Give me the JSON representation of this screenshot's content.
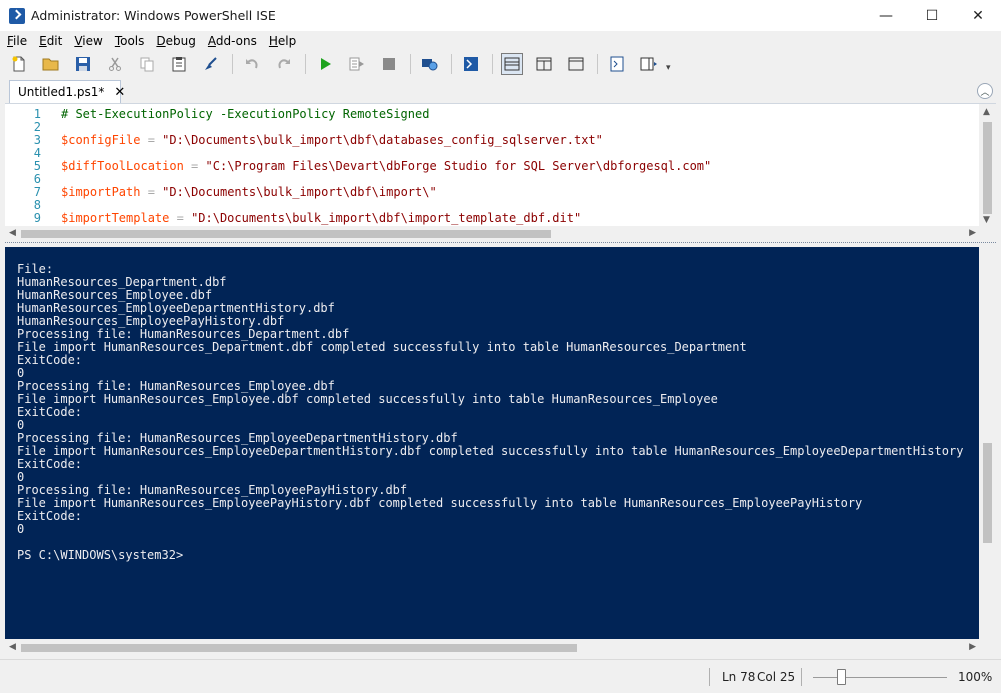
{
  "window": {
    "title": "Administrator: Windows PowerShell ISE",
    "minimize": "—",
    "maximize": "☐",
    "close": "✕"
  },
  "menu": [
    "File",
    "Edit",
    "View",
    "Tools",
    "Debug",
    "Add-ons",
    "Help"
  ],
  "tab": {
    "label": "Untitled1.ps1*",
    "close": "✕"
  },
  "script": {
    "lines": [
      {
        "n": "1",
        "parts": [
          {
            "t": "# Set-ExecutionPolicy -ExecutionPolicy RemoteSigned",
            "c": "comment"
          }
        ]
      },
      {
        "n": "2",
        "parts": []
      },
      {
        "n": "3",
        "parts": [
          {
            "t": "$configFile",
            "c": "var"
          },
          {
            "t": " = ",
            "c": "op"
          },
          {
            "t": "\"D:\\Documents\\bulk_import\\dbf\\databases_config_sqlserver.txt\"",
            "c": "str"
          }
        ]
      },
      {
        "n": "4",
        "parts": []
      },
      {
        "n": "5",
        "parts": [
          {
            "t": "$diffToolLocation",
            "c": "var"
          },
          {
            "t": " = ",
            "c": "op"
          },
          {
            "t": "\"C:\\Program Files\\Devart\\dbForge Studio for SQL Server\\dbforgesql.com\"",
            "c": "str"
          }
        ]
      },
      {
        "n": "6",
        "parts": []
      },
      {
        "n": "7",
        "parts": [
          {
            "t": "$importPath",
            "c": "var"
          },
          {
            "t": " = ",
            "c": "op"
          },
          {
            "t": "\"D:\\Documents\\bulk_import\\dbf\\import\\\"",
            "c": "str"
          }
        ]
      },
      {
        "n": "8",
        "parts": []
      },
      {
        "n": "9",
        "parts": [
          {
            "t": "$importTemplate",
            "c": "var"
          },
          {
            "t": " = ",
            "c": "op"
          },
          {
            "t": "\"D:\\Documents\\bulk_import\\dbf\\import_template_dbf.dit\"",
            "c": "str"
          }
        ]
      }
    ]
  },
  "console": {
    "lines": [
      "File:",
      "HumanResources_Department.dbf",
      "HumanResources_Employee.dbf",
      "HumanResources_EmployeeDepartmentHistory.dbf",
      "HumanResources_EmployeePayHistory.dbf",
      "Processing file: HumanResources_Department.dbf",
      "File import HumanResources_Department.dbf completed successfully into table HumanResources_Department",
      "ExitCode:",
      "0",
      "Processing file: HumanResources_Employee.dbf",
      "File import HumanResources_Employee.dbf completed successfully into table HumanResources_Employee",
      "ExitCode:",
      "0",
      "Processing file: HumanResources_EmployeeDepartmentHistory.dbf",
      "File import HumanResources_EmployeeDepartmentHistory.dbf completed successfully into table HumanResources_EmployeeDepartmentHistory",
      "ExitCode:",
      "0",
      "Processing file: HumanResources_EmployeePayHistory.dbf",
      "File import HumanResources_EmployeePayHistory.dbf completed successfully into table HumanResources_EmployeePayHistory",
      "ExitCode:",
      "0",
      "",
      "PS C:\\WINDOWS\\system32>"
    ]
  },
  "status": {
    "ln": "Ln 78",
    "col": "Col 25",
    "zoom": "100%"
  },
  "colors": {
    "console_bg": "#012456",
    "console_fg": "#eeedf0",
    "comment": "#006400",
    "variable": "#ff4500",
    "string": "#8b0000",
    "line_number": "#2b91af"
  }
}
